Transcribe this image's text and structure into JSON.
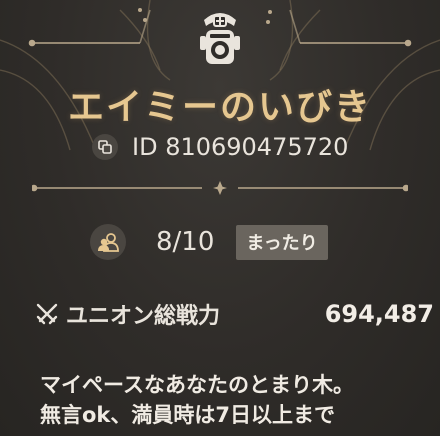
{
  "club": {
    "name": "エイミーのいびき",
    "id_text": "ID 810690475720"
  },
  "members": {
    "count_text": "8/10",
    "style_tag": "まったり"
  },
  "union_power": {
    "label": "ユニオン総戦力",
    "value": "694,487"
  },
  "description": {
    "line1": "マイペースなあなたのとまり木。",
    "line2": "無言ok、満員時は7日以上まで"
  },
  "colors": {
    "background": "#2f2c29",
    "accent_gold": "#e6c790",
    "icon_circle": "#4a4641",
    "tag_bg": "#6a655e"
  },
  "icons": {
    "emblem": "club-emblem-icon",
    "copy": "copy-icon",
    "members": "members-icon",
    "power": "crossed-swords-icon"
  }
}
